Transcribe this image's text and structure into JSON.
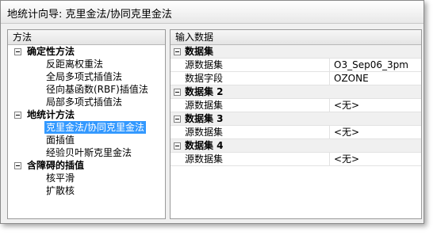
{
  "window": {
    "title": "地统计向导: 克里金法/协同克里金法"
  },
  "left_panel": {
    "header": "方法",
    "groups": [
      {
        "label": "确定性方法",
        "items": [
          "反距离权重法",
          "全局多项式插值法",
          "径向基函数(RBF)插值法",
          "局部多项式插值法"
        ]
      },
      {
        "label": "地统计方法",
        "items": [
          "克里金法/协同克里金法",
          "面插值",
          "经验贝叶斯克里金法"
        ]
      },
      {
        "label": "含障碍的插值",
        "items": [
          "核平滑",
          "扩散核"
        ]
      }
    ],
    "selected": "克里金法/协同克里金法"
  },
  "right_panel": {
    "header": "输入数据",
    "sections": [
      {
        "label": "数据集",
        "rows": [
          {
            "prop": "源数据集",
            "value": "O3_Sep06_3pm"
          },
          {
            "prop": "数据字段",
            "value": "OZONE"
          }
        ]
      },
      {
        "label": "数据集 2",
        "rows": [
          {
            "prop": "源数据集",
            "value": "<无>"
          }
        ]
      },
      {
        "label": "数据集 3",
        "rows": [
          {
            "prop": "源数据集",
            "value": "<无>"
          }
        ]
      },
      {
        "label": "数据集 4",
        "rows": [
          {
            "prop": "源数据集",
            "value": "<无>"
          }
        ]
      }
    ]
  }
}
